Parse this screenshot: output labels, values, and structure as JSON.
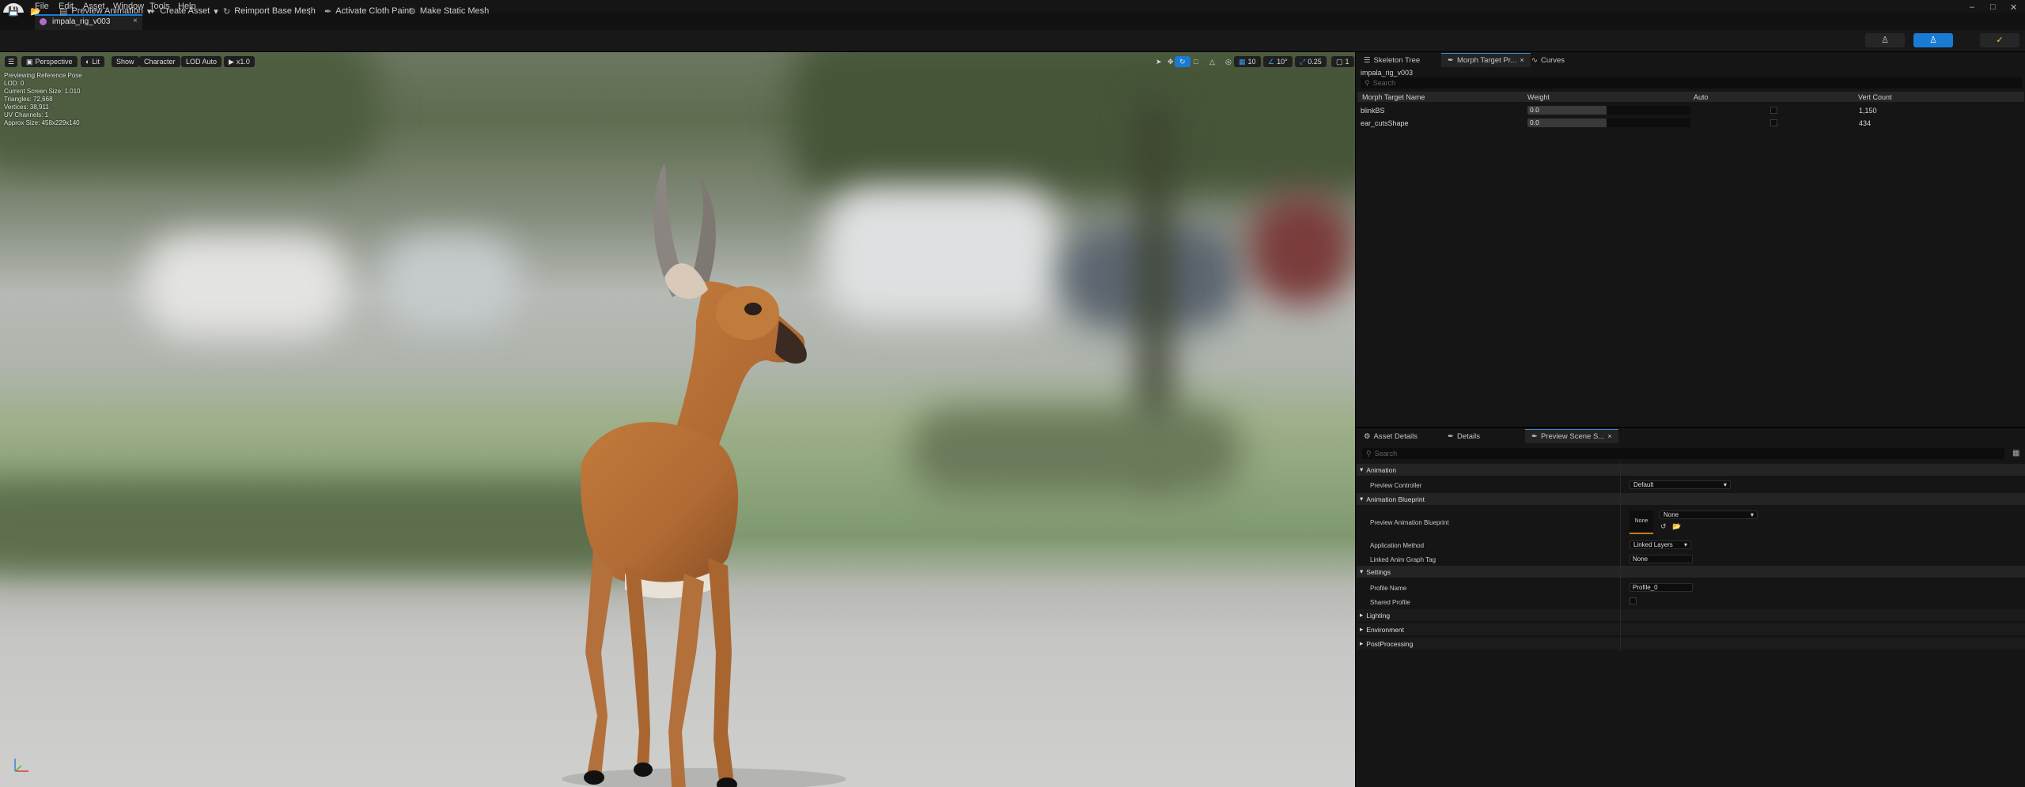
{
  "menu": {
    "file": "File",
    "edit": "Edit",
    "asset": "Asset",
    "window": "Window",
    "tools": "Tools",
    "help": "Help"
  },
  "window_controls": {
    "minimize": "–",
    "maximize": "□",
    "close": "✕"
  },
  "document_tab": {
    "label": "impala_rig_v003",
    "close": "×"
  },
  "toolbar": {
    "preview_animation": "Preview Animation",
    "create_asset": "Create Asset",
    "reimport_base_mesh": "Reimport Base Mesh",
    "activate_cloth_paint": "Activate Cloth Paint",
    "make_static_mesh": "Make Static Mesh"
  },
  "viewport": {
    "buttons": {
      "perspective": "Perspective",
      "lit": "Lit",
      "show": "Show",
      "character": "Character",
      "lod": "LOD Auto",
      "speed": "x1.0"
    },
    "right_controls": {
      "grid": "10",
      "angle": "10°",
      "scale": "0.25",
      "camera": "1"
    },
    "stats": [
      "Previewing Reference Pose",
      "LOD: 0",
      "Current Screen Size: 1.010",
      "Triangles: 72,668",
      "Vertices: 38,911",
      "UV Channels: 1",
      "Approx Size: 458x229x140"
    ],
    "axis_icon": "axis-indicator"
  },
  "morph_panel": {
    "tabs": {
      "skeleton": "Skeleton Tree",
      "morph": "Morph Target Pr...",
      "curves": "Curves"
    },
    "asset_name": "impala_rig_v003",
    "search_placeholder": "Search",
    "columns": {
      "name": "Morph Target Name",
      "weight": "Weight",
      "auto": "Auto",
      "vert": "Vert Count"
    },
    "rows": [
      {
        "name": "blinkBS",
        "weight": "0.0",
        "vert": "1,150"
      },
      {
        "name": "ear_cutsShape",
        "weight": "0.0",
        "vert": "434"
      }
    ]
  },
  "details_panel": {
    "tabs": {
      "asset_details": "Asset Details",
      "details": "Details",
      "preview_scene": "Preview Scene S..."
    },
    "search_placeholder": "Search",
    "sections": {
      "animation": "Animation",
      "animation_blueprint": "Animation Blueprint",
      "settings": "Settings",
      "lighting": "Lighting",
      "environment": "Environment",
      "postprocessing": "PostProcessing"
    },
    "props": {
      "preview_controller": {
        "label": "Preview Controller",
        "value": "Default"
      },
      "preview_anim_bp": {
        "label": "Preview Animation Blueprint",
        "thumb": "None",
        "value": "None"
      },
      "application_method": {
        "label": "Application Method",
        "value": "Linked Layers"
      },
      "linked_anim_graph_tag": {
        "label": "Linked Anim Graph Tag",
        "value": "None"
      },
      "profile_name": {
        "label": "Profile Name",
        "value": "Profile_0"
      },
      "shared_profile": {
        "label": "Shared Profile"
      }
    }
  },
  "colors": {
    "accent": "#1a7bd4",
    "panel": "#151515",
    "toolbar": "#181818"
  }
}
